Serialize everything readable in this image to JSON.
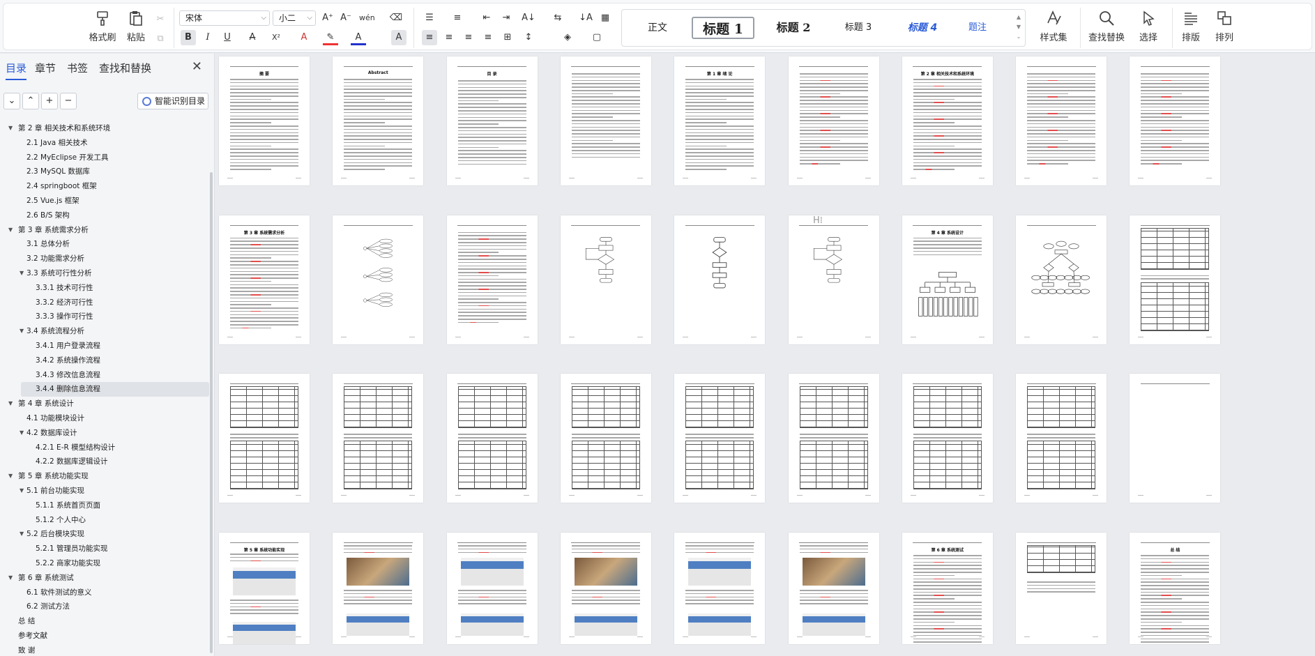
{
  "ribbon": {
    "format_painter": "格式刷",
    "paste": "粘贴",
    "font_name": "宋体",
    "font_size": "小二",
    "styles": [
      {
        "label": "正文"
      },
      {
        "label": "标题 1"
      },
      {
        "label": "标题 2"
      },
      {
        "label": "标题 3"
      },
      {
        "label": "标题 4"
      },
      {
        "label": "题注"
      }
    ],
    "style_set": "样式集",
    "find_replace": "查找替换",
    "select": "选择",
    "layout": "排版",
    "arrange": "排列"
  },
  "sidebar": {
    "tabs": [
      "目录",
      "章节",
      "书签",
      "查找和替换"
    ],
    "smart_toc": "智能识别目录",
    "toc": [
      {
        "text": "第 2 章  相关技术和系统环境",
        "level": 0
      },
      {
        "text": "2.1 Java 相关技术",
        "level": 1
      },
      {
        "text": "2.2 MyEclipse 开发工具",
        "level": 1
      },
      {
        "text": "2.3 MySQL 数据库",
        "level": 1
      },
      {
        "text": "2.4 springboot 框架",
        "level": 1
      },
      {
        "text": "2.5 Vue.js 框架",
        "level": 1
      },
      {
        "text": "2.6 B/S 架构",
        "level": 1
      },
      {
        "text": "第 3 章  系统需求分析",
        "level": 0
      },
      {
        "text": "3.1 总体分析",
        "level": 1
      },
      {
        "text": "3.2 功能需求分析",
        "level": 1
      },
      {
        "text": "3.3  系统可行性分析",
        "level": 1,
        "expanded": true
      },
      {
        "text": "3.3.1 技术可行性",
        "level": 2
      },
      {
        "text": "3.3.2 经济可行性",
        "level": 2
      },
      {
        "text": "3.3.3 操作可行性",
        "level": 2
      },
      {
        "text": "3.4 系统流程分析",
        "level": 1,
        "expanded": true
      },
      {
        "text": "3.4.1  用户登录流程",
        "level": 2
      },
      {
        "text": "3.4.2  系统操作流程",
        "level": 2
      },
      {
        "text": "3.4.3 修改信息流程",
        "level": 2
      },
      {
        "text": "3.4.4 删除信息流程",
        "level": 2,
        "selected": true
      },
      {
        "text": "第 4 章  系统设计",
        "level": 0
      },
      {
        "text": "4.1  功能模块设计",
        "level": 1
      },
      {
        "text": "4.2  数据库设计",
        "level": 1,
        "expanded": true
      },
      {
        "text": "4.2.1 E-R 模型结构设计",
        "level": 2
      },
      {
        "text": "4.2.2  数据库逻辑设计",
        "level": 2
      },
      {
        "text": "第 5 章  系统功能实现",
        "level": 0
      },
      {
        "text": "5.1 前台功能实现",
        "level": 1,
        "expanded": true
      },
      {
        "text": "5.1.1 系统首页页面",
        "level": 2
      },
      {
        "text": "5.1.2 个人中心",
        "level": 2
      },
      {
        "text": "5.2 后台模块实现",
        "level": 1,
        "expanded": true
      },
      {
        "text": "5.2.1 管理员功能实现",
        "level": 2
      },
      {
        "text": "5.2.2 商家功能实现",
        "level": 2
      },
      {
        "text": "第 6 章  系统测试",
        "level": 0
      },
      {
        "text": "6.1  软件测试的意义",
        "level": 1
      },
      {
        "text": "6.2  测试方法",
        "level": 1
      },
      {
        "text": "总  结",
        "level": 0,
        "leaf": true
      },
      {
        "text": "参考文献",
        "level": 0,
        "leaf": true
      },
      {
        "text": "致  谢",
        "level": 0,
        "leaf": true
      }
    ]
  },
  "pages": [
    {
      "kind": "text",
      "title": "摘  要"
    },
    {
      "kind": "text",
      "title": "Abstract"
    },
    {
      "kind": "toc",
      "title": "目  录"
    },
    {
      "kind": "toc",
      "title": ""
    },
    {
      "kind": "text",
      "title": "第 1 章  绪 论"
    },
    {
      "kind": "text",
      "title": ""
    },
    {
      "kind": "text",
      "title": "第 2 章  相关技术和系统环境"
    },
    {
      "kind": "text",
      "title": ""
    },
    {
      "kind": "text",
      "title": ""
    },
    {
      "kind": "text",
      "title": "第 3 章  系统需求分析"
    },
    {
      "kind": "usecase",
      "title": ""
    },
    {
      "kind": "text",
      "title": ""
    },
    {
      "kind": "flow",
      "title": ""
    },
    {
      "kind": "flowtext",
      "title": ""
    },
    {
      "kind": "flow",
      "title": ""
    },
    {
      "kind": "module",
      "title": "第 4 章  系统设计"
    },
    {
      "kind": "er",
      "title": ""
    },
    {
      "kind": "tables",
      "title": ""
    },
    {
      "kind": "tables",
      "title": ""
    },
    {
      "kind": "tables",
      "title": ""
    },
    {
      "kind": "tables",
      "title": ""
    },
    {
      "kind": "tables",
      "title": ""
    },
    {
      "kind": "tables",
      "title": ""
    },
    {
      "kind": "tables",
      "title": ""
    },
    {
      "kind": "tables",
      "title": ""
    },
    {
      "kind": "tables",
      "title": ""
    },
    {
      "kind": "blank",
      "title": ""
    },
    {
      "kind": "screens",
      "title": "第 5 章  系统功能实现"
    },
    {
      "kind": "screens",
      "title": ""
    },
    {
      "kind": "screens",
      "title": ""
    },
    {
      "kind": "screens",
      "title": ""
    },
    {
      "kind": "screens",
      "title": ""
    },
    {
      "kind": "screens",
      "title": ""
    },
    {
      "kind": "text",
      "title": "第 6 章  系统测试"
    },
    {
      "kind": "tabletext",
      "title": ""
    },
    {
      "kind": "text",
      "title": "总  结"
    }
  ],
  "colors": {
    "accent": "#2a5bd7",
    "ribbon_bg": "#f7f8fa",
    "canvas": "#e9ebef"
  }
}
